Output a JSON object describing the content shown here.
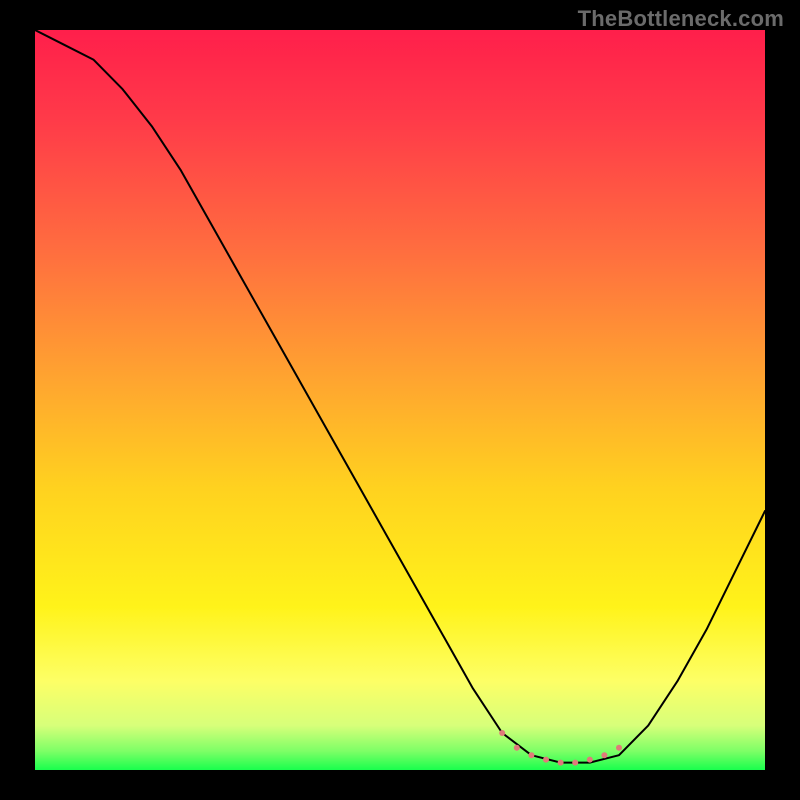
{
  "watermark": "TheBottleneck.com",
  "colors": {
    "background": "#000000",
    "watermark": "#6b6b6b",
    "curve_stroke": "#000000",
    "marker_fill": "#e07a7a",
    "gradient_stops": [
      {
        "offset": 0.0,
        "color": "#ff1f4b"
      },
      {
        "offset": 0.12,
        "color": "#ff3a49"
      },
      {
        "offset": 0.3,
        "color": "#ff6e3f"
      },
      {
        "offset": 0.48,
        "color": "#ffa72f"
      },
      {
        "offset": 0.62,
        "color": "#ffd21f"
      },
      {
        "offset": 0.78,
        "color": "#fff31a"
      },
      {
        "offset": 0.88,
        "color": "#fdff66"
      },
      {
        "offset": 0.94,
        "color": "#d7ff7a"
      },
      {
        "offset": 0.975,
        "color": "#7cff66"
      },
      {
        "offset": 1.0,
        "color": "#19ff4d"
      }
    ]
  },
  "chart_data": {
    "type": "line",
    "title": "",
    "xlabel": "",
    "ylabel": "",
    "xlim": [
      0,
      100
    ],
    "ylim": [
      0,
      100
    ],
    "grid": false,
    "series": [
      {
        "name": "bottleneck-curve",
        "x": [
          0,
          4,
          8,
          12,
          16,
          20,
          24,
          28,
          32,
          36,
          40,
          44,
          48,
          52,
          56,
          60,
          64,
          68,
          72,
          76,
          80,
          84,
          88,
          92,
          96,
          100
        ],
        "y": [
          100,
          98,
          96,
          92,
          87,
          81,
          74,
          67,
          60,
          53,
          46,
          39,
          32,
          25,
          18,
          11,
          5,
          2,
          1,
          1,
          2,
          6,
          12,
          19,
          27,
          35
        ]
      }
    ],
    "markers": {
      "name": "valley-markers",
      "x": [
        64,
        66,
        68,
        70,
        72,
        74,
        76,
        78,
        80
      ],
      "y": [
        5,
        3,
        2,
        1.4,
        1,
        1,
        1.4,
        2,
        3
      ],
      "sizes": [
        3,
        3,
        3,
        3,
        3,
        3,
        3,
        3,
        3
      ]
    }
  }
}
